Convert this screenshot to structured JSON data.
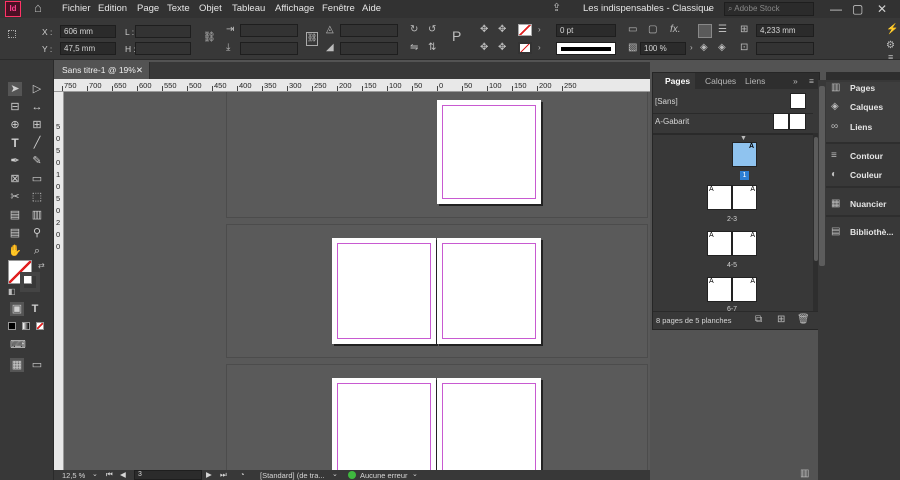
{
  "app": {
    "logo": "Id",
    "workspace": "Les indispensables - Classique",
    "search_placeholder": "Adobe Stock"
  },
  "menus": [
    "Fichier",
    "Edition",
    "Page",
    "Texte",
    "Objet",
    "Tableau",
    "Affichage",
    "Fenêtre",
    "Aide"
  ],
  "control": {
    "x_label": "X :",
    "x_value": "606 mm",
    "y_label": "Y :",
    "y_value": "47,5 mm",
    "l_label": "L :",
    "h_label": "H :",
    "stroke_weight": "0 pt",
    "opacity": "100 %",
    "gutter": "4,233 mm"
  },
  "document": {
    "tab_title": "Sans titre-1 @ 19%",
    "ruler_ticks": [
      "750",
      "700",
      "650",
      "600",
      "550",
      "500",
      "450",
      "400",
      "350",
      "300",
      "250",
      "200",
      "150",
      "100",
      "50",
      "0",
      "50",
      "100",
      "150",
      "200",
      "250"
    ],
    "vruler_ticks": [
      "5",
      "0",
      "5",
      "0",
      "1",
      "0",
      "5",
      "0",
      "2",
      "0",
      "0"
    ]
  },
  "status": {
    "zoom": "12,5 %",
    "page": "3",
    "style": "[Standard] (de tra...",
    "preflight": "Aucune erreur"
  },
  "pages_panel": {
    "tabs": [
      "Pages",
      "Calques",
      "Liens"
    ],
    "masters": [
      "[Sans]",
      "A-Gabarit"
    ],
    "spread_labels": [
      "1",
      "2-3",
      "4-5",
      "6-7"
    ],
    "master_letter": "A",
    "footer": "8 pages de 5 planches"
  },
  "dock": [
    "Pages",
    "Calques",
    "Liens",
    "Contour",
    "Couleur",
    "Nuancier",
    "Bibliothè..."
  ],
  "colors": {
    "accent": "#ff3366",
    "margin": "#c85ad1",
    "selected_page": "#8fc3ef",
    "badge": "#2d7fd4",
    "ok": "#3fb93f"
  }
}
